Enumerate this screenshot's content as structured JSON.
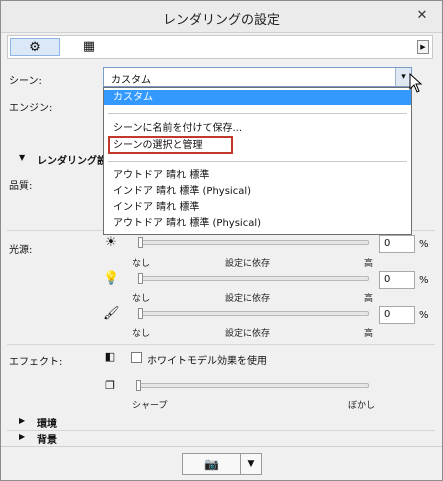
{
  "window": {
    "title": "レンダリングの設定",
    "close_icon": "✕"
  },
  "toolbar": {
    "gear_icon": "⚙",
    "panel_icon": "▦",
    "arrow_icon": "▶"
  },
  "scene": {
    "label": "シーン:",
    "value": "カスタム",
    "dropdown_icon": "▾"
  },
  "engine": {
    "label": "エンジン:"
  },
  "dropdown": {
    "items": [
      "カスタム",
      "シーンに名前を付けて保存...",
      "シーンの選択と管理",
      "アウトドア 晴れ 標準",
      "インドア 晴れ 標準 (Physical)",
      "インドア 晴れ 標準",
      "アウトドア 晴れ 標準 (Physical)"
    ]
  },
  "rendering_section": {
    "title": "レンダリング設",
    "triangle": "▼"
  },
  "quality": {
    "label": "品質:"
  },
  "light": {
    "label": "光源:",
    "rows": [
      {
        "icon": "☀",
        "value": "0",
        "unit": "%",
        "min": "なし",
        "mid": "設定に依存",
        "max": "高",
        "level": 0
      },
      {
        "icon": "💡",
        "value": "0",
        "unit": "%",
        "min": "なし",
        "mid": "設定に依存",
        "max": "高",
        "level": 0
      },
      {
        "icon": "🖌",
        "value": "0",
        "unit": "%",
        "min": "なし",
        "mid": "設定に依存",
        "max": "高",
        "level": 0
      }
    ]
  },
  "effect": {
    "label": "エフェクト:",
    "checkbox_label": "ホワイトモデル効果を使用",
    "slider_min": "シャープ",
    "slider_max": "ぼかし"
  },
  "environment": {
    "title": "環境",
    "triangle": "▶"
  },
  "background": {
    "title": "背景",
    "triangle": "▶"
  },
  "bottom": {
    "camera_icon": "📷",
    "split_icon": "▼"
  }
}
